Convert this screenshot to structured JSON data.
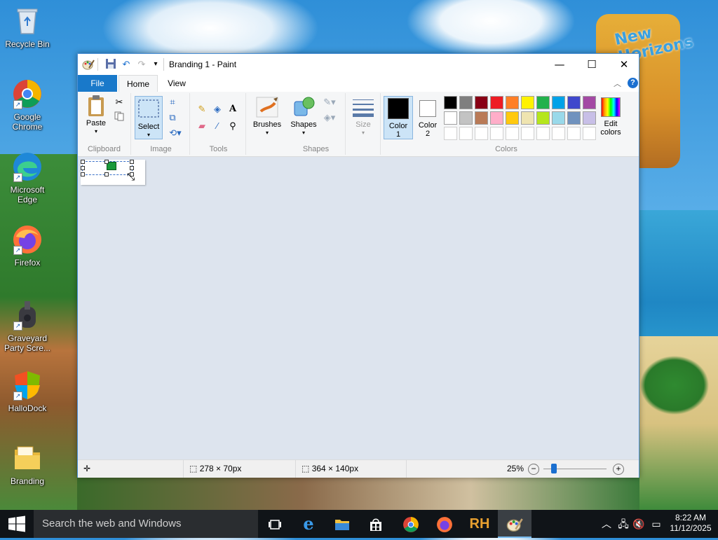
{
  "desktop": {
    "icons": [
      {
        "label": "Recycle Bin",
        "icon": "recycle-bin-icon"
      },
      {
        "label": "Google Chrome",
        "icon": "chrome-icon"
      },
      {
        "label": "Microsoft Edge",
        "icon": "edge-icon"
      },
      {
        "label": "Firefox",
        "icon": "firefox-icon"
      },
      {
        "label": "Graveyard Party Scre...",
        "icon": "graveyard-game-icon"
      },
      {
        "label": "HalloDock",
        "icon": "hallodock-icon"
      },
      {
        "label": "Branding",
        "icon": "folder-icon"
      }
    ],
    "wallpaper_sign_text": "New Horizons"
  },
  "window": {
    "title": "Branding 1 - Paint",
    "controls": {
      "minimize": "—",
      "maximize": "☐",
      "close": "✕"
    }
  },
  "tabs": {
    "file": "File",
    "home": "Home",
    "view": "View"
  },
  "ribbon": {
    "clipboard": {
      "label": "Clipboard",
      "paste": "Paste"
    },
    "image": {
      "label": "Image",
      "select": "Select"
    },
    "tools": {
      "label": "Tools"
    },
    "shapes": {
      "label": "Shapes",
      "brushes": "Brushes",
      "shapes": "Shapes",
      "size": "Size"
    },
    "colors": {
      "label": "Colors",
      "color1": "Color 1",
      "color2": "Color 2",
      "edit_colors": "Edit colors",
      "color1_value": "#000000",
      "color2_value": "#ffffff",
      "row1": [
        "#000000",
        "#7f7f7f",
        "#880015",
        "#ed1c24",
        "#ff7f27",
        "#fff200",
        "#22b14c",
        "#00a2e8",
        "#3f48cc",
        "#a349a4"
      ],
      "row2": [
        "#ffffff",
        "#c3c3c3",
        "#b97a57",
        "#ffaec9",
        "#ffc90e",
        "#efe4b0",
        "#b5e61d",
        "#99d9ea",
        "#7092be",
        "#c8bfe7"
      ]
    }
  },
  "status": {
    "selection_size": "278 × 70px",
    "image_size": "364 × 140px",
    "zoom": "25%",
    "zoom_fraction": 0.25
  },
  "taskbar": {
    "search_placeholder": "Search the web and Windows",
    "apps": [
      "task-view-icon",
      "edge-icon",
      "file-explorer-icon",
      "store-icon",
      "chrome-icon",
      "firefox-icon",
      "rh-icon",
      "paint-icon"
    ],
    "rh_label": "RH",
    "time": "8:22 AM",
    "date": "11/12/2025"
  }
}
